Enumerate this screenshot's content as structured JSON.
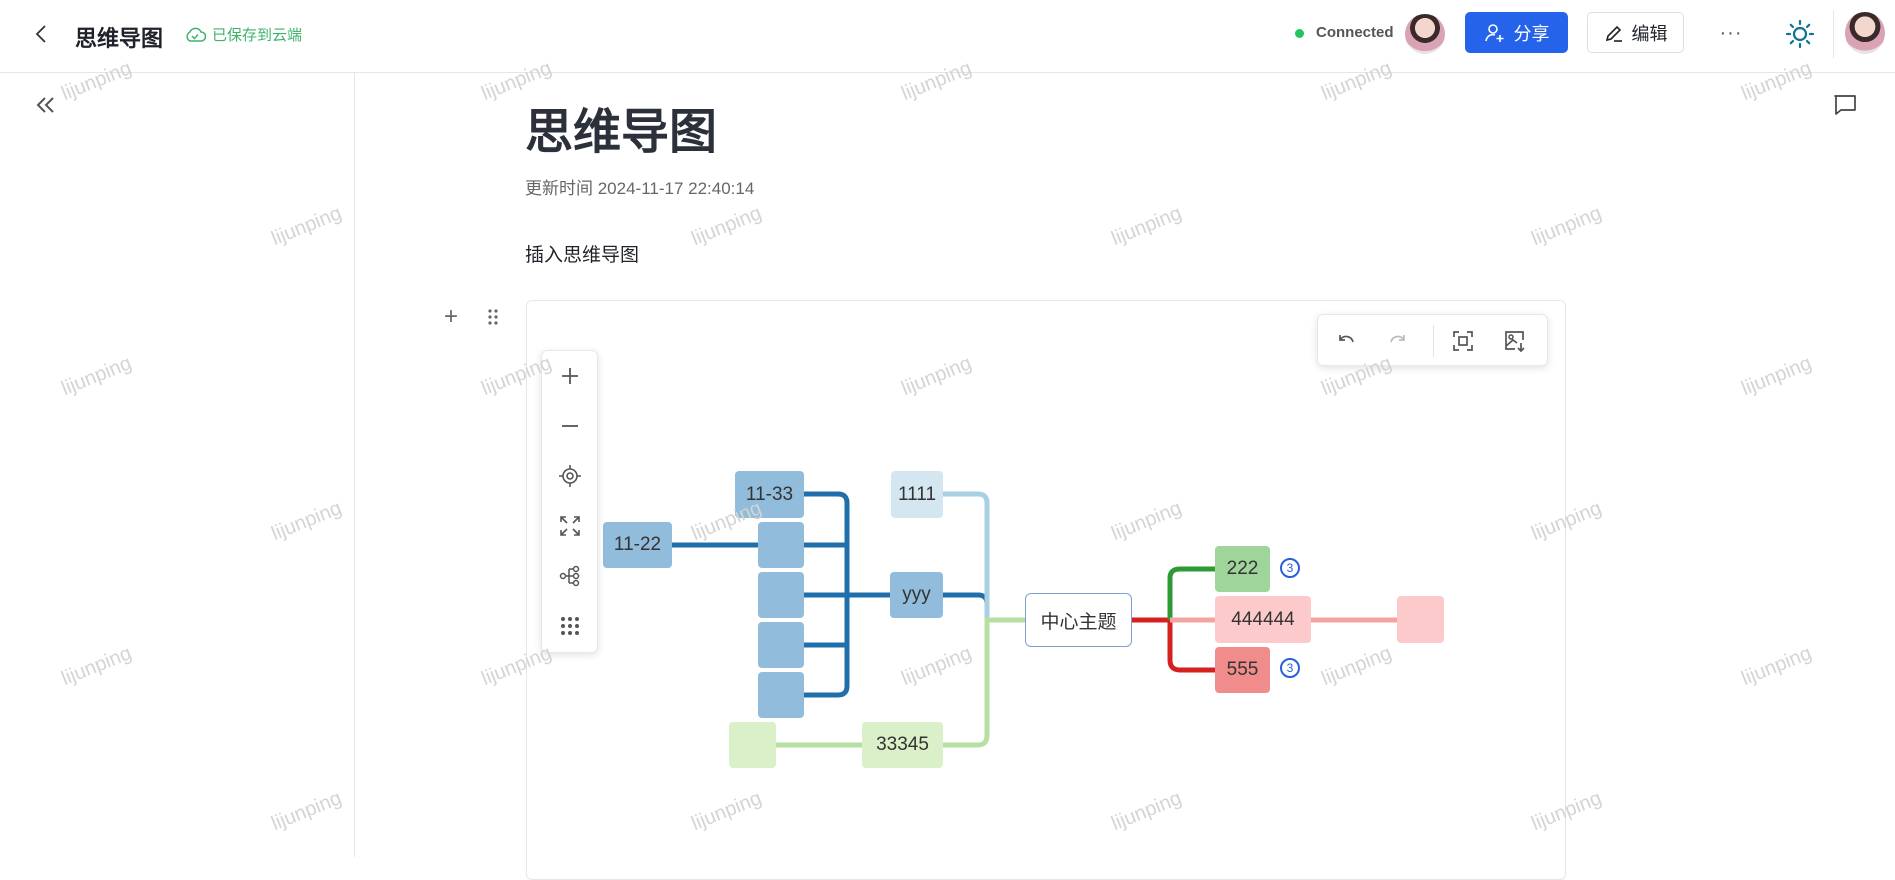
{
  "header": {
    "title": "思维导图",
    "save_status": "已保存到云端",
    "connection_status": "Connected",
    "connection_color": "#22c55e",
    "share_label": "分享",
    "edit_label": "编辑",
    "accent": "#2563eb"
  },
  "doc": {
    "title": "思维导图",
    "updated": "更新时间 2024-11-17 22:40:14",
    "paragraph": "插入思维导图"
  },
  "mindmap": {
    "root": "中心主题",
    "nodes": {
      "n1122": "11-22",
      "n1133": "11-33",
      "n1111": "1111",
      "yyy": "yyy",
      "n33345": "33345",
      "n222": "222",
      "n444444": "444444",
      "n555": "555"
    },
    "badges": {
      "n222": "3",
      "n555": "3"
    },
    "colors": {
      "blue": "#1f6fad",
      "lightblue": "#a8cfe3",
      "green": "#b5e0a0",
      "red": "#d62020",
      "pink": "#f4a3a3",
      "darkgreen": "#2e9a35"
    }
  },
  "watermark": "lijunping"
}
